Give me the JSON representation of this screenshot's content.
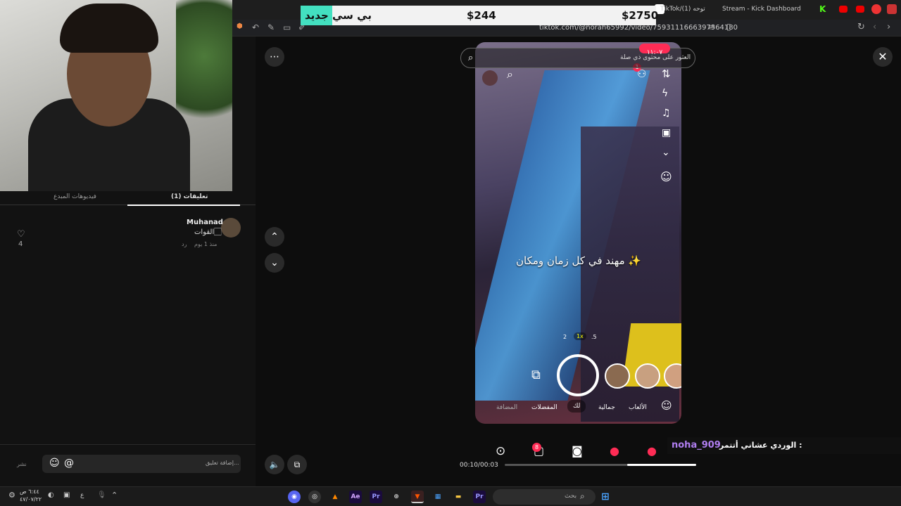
{
  "browser": {
    "tabs": [
      {
        "label": "TikTok/(1) توحه"
      },
      {
        "label": "Stream - Kick Dashboard"
      }
    ],
    "url": "tiktok.com/@norah65992/video/7593111666397564180"
  },
  "goal_overlay": {
    "label": "بي سي جديد",
    "current": "$244",
    "target": "$2750",
    "progress": 0.09
  },
  "left_panel": {
    "tabs": [
      {
        "label": "(1) تعليقات",
        "active": true
      },
      {
        "label": "فيديوهات المبدع",
        "active": false
      }
    ],
    "comment": {
      "author": "Muhanad",
      "text": "القوات🏻",
      "meta": "منذ 1 يوم",
      "reply": "رد",
      "likes": "4"
    },
    "input_placeholder": "إضافة تعليق...",
    "post_label": "نشر"
  },
  "video": {
    "search_text": "العثور على محتوى ذي صلة",
    "timer_badge": "١١:٠٧",
    "notif_count": "1",
    "caption": "مهند في كل زمان ومكان ✨",
    "zoom": [
      "2",
      "1x",
      ".5"
    ],
    "modes": [
      "الألعاب",
      "جمالية",
      "لك",
      "المفضلات",
      "المضافة"
    ],
    "active_mode": "لك",
    "time": "00:10/00:03",
    "progress": 0.36,
    "msg_count": "8"
  },
  "chat": {
    "user": "noha_909",
    "message": "الوردي عشاني أتتمر :"
  },
  "taskbar": {
    "time": "٦:٤٤ ص",
    "date": "٤٧/٠٧/٢٢",
    "lang": "ع",
    "search_placeholder": "بحث"
  },
  "colors": {
    "accent": "#fe2c55",
    "goal_fill": "#43e0c0",
    "chat_user": "#b07ef0"
  }
}
